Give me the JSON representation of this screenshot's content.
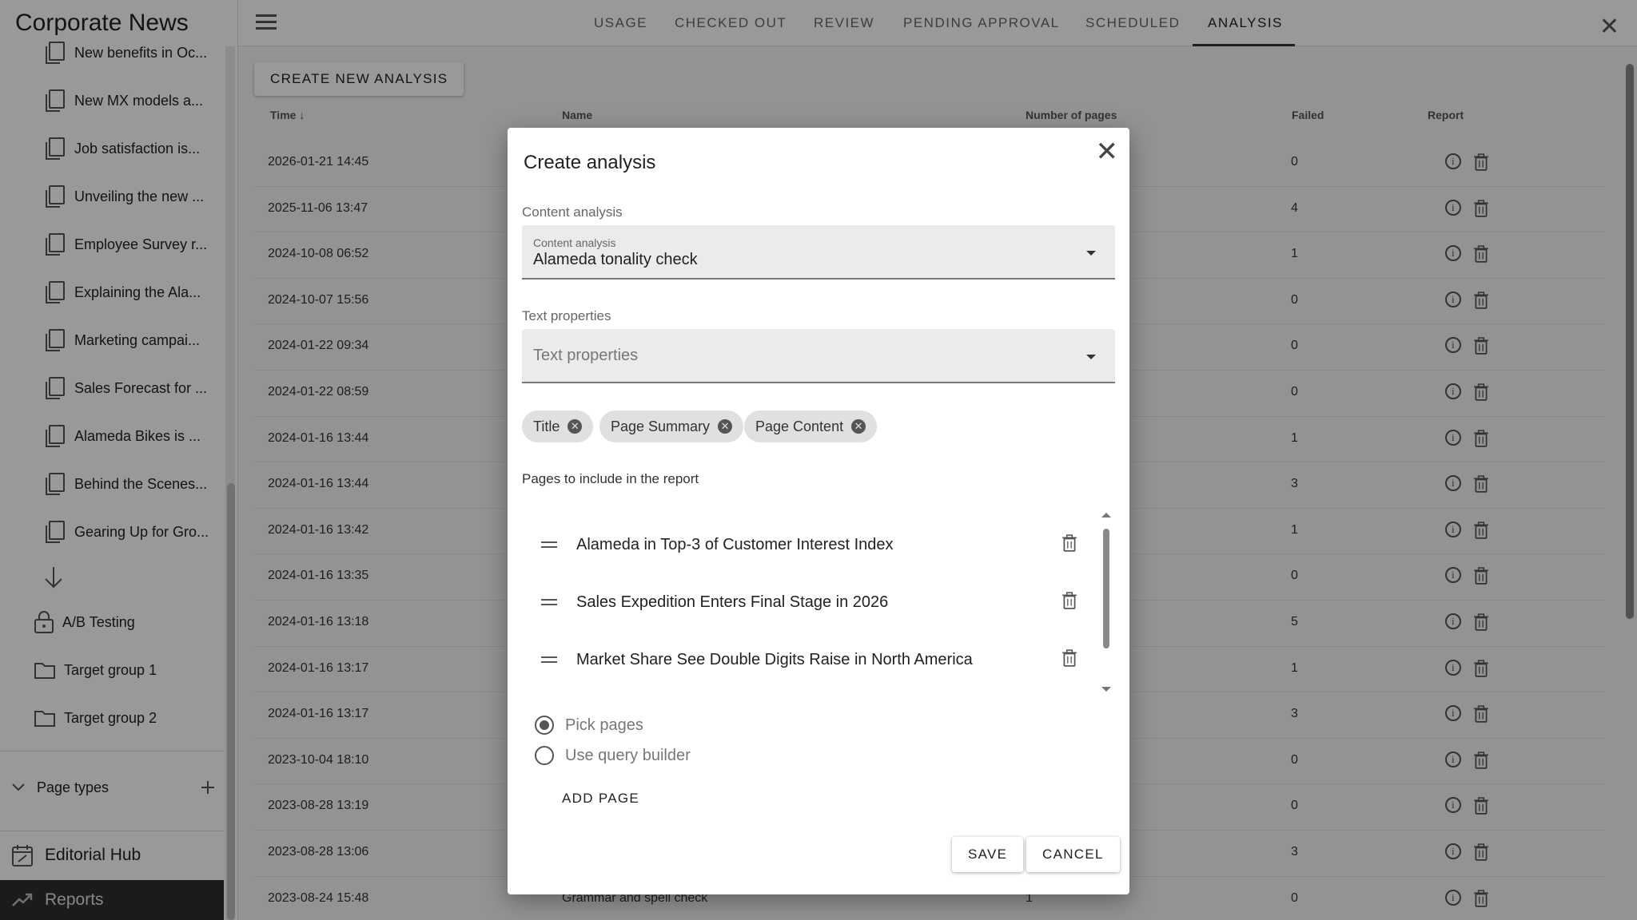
{
  "app": {
    "title": "Corporate News"
  },
  "sidebar": {
    "pages": [
      "New benefits in Oc...",
      "New MX models a...",
      "Job satisfaction is...",
      "Unveiling the new ...",
      "Employee Survey r...",
      "Explaining the Ala...",
      "Marketing campai...",
      "Sales Forecast for ...",
      "Alameda Bikes is ...",
      "Behind the Scenes...",
      "Gearing Up for Gro..."
    ],
    "folders": [
      "A/B Testing",
      "Target group 1",
      "Target group 2"
    ],
    "page_types_label": "Page types",
    "nav": {
      "editorial_hub": "Editorial Hub",
      "reports": "Reports"
    }
  },
  "topbar": {
    "tabs": [
      "USAGE",
      "CHECKED OUT",
      "REVIEW",
      "PENDING APPROVAL",
      "SCHEDULED",
      "ANALYSIS"
    ],
    "active_tab": "ANALYSIS"
  },
  "main": {
    "create_button": "CREATE NEW ANALYSIS",
    "columns": {
      "time": "Time",
      "name": "Name",
      "pages": "Number of pages",
      "failed": "Failed",
      "report": "Report"
    },
    "rows": [
      {
        "time": "2026-01-21 14:45",
        "failed": "0"
      },
      {
        "time": "2025-11-06 13:47",
        "failed": "4"
      },
      {
        "time": "2024-10-08 06:52",
        "failed": "1"
      },
      {
        "time": "2024-10-07 15:56",
        "failed": "0"
      },
      {
        "time": "2024-01-22 09:34",
        "failed": "0"
      },
      {
        "time": "2024-01-22 08:59",
        "failed": "0"
      },
      {
        "time": "2024-01-16 13:44",
        "failed": "1"
      },
      {
        "time": "2024-01-16 13:44",
        "failed": "3"
      },
      {
        "time": "2024-01-16 13:42",
        "failed": "1"
      },
      {
        "time": "2024-01-16 13:35",
        "failed": "0"
      },
      {
        "time": "2024-01-16 13:18",
        "failed": "5"
      },
      {
        "time": "2024-01-16 13:17",
        "failed": "1"
      },
      {
        "time": "2024-01-16 13:17",
        "failed": "3"
      },
      {
        "time": "2023-10-04 18:10",
        "failed": "0"
      },
      {
        "time": "2023-08-28 13:19",
        "failed": "0"
      },
      {
        "time": "2023-08-28 13:06",
        "failed": "3"
      },
      {
        "time": "2023-08-24 15:48",
        "name": "Grammar and spell check",
        "pages": "1",
        "failed": "0"
      }
    ]
  },
  "dialog": {
    "title": "Create analysis",
    "content_analysis": {
      "section_label": "Content analysis",
      "field_label": "Content analysis",
      "value": "Alameda tonality check"
    },
    "text_properties": {
      "section_label": "Text properties",
      "placeholder": "Text properties",
      "chips": [
        "Title",
        "Page Summary",
        "Page Content"
      ]
    },
    "pages_label": "Pages to include in the report",
    "pages": [
      "Alameda in Top-3 of Customer Interest Index",
      "Sales Expedition Enters Final Stage in 2026",
      "Market Share See Double Digits Raise in North America"
    ],
    "radio": {
      "pick_pages": "Pick pages",
      "query_builder": "Use query builder",
      "selected": "Pick pages"
    },
    "add_page": "ADD PAGE",
    "save": "SAVE",
    "cancel": "CANCEL"
  }
}
